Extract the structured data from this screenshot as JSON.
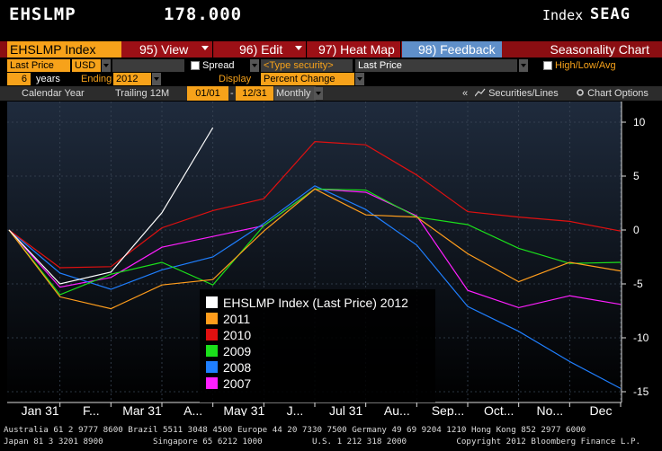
{
  "header": {
    "ticker": "EHSLMP",
    "last_value": "178.000",
    "index_label": "Index",
    "index_code": "SEAG"
  },
  "menu": {
    "security": "EHSLMP Index",
    "view": "95) View",
    "edit": "96) Edit",
    "heat_map": "97) Heat Map",
    "feedback": "98) Feedback",
    "title": "Seasonality Chart"
  },
  "controls": {
    "field": "Last Price",
    "currency": "USD",
    "spread_label": "Spread",
    "type_security_placeholder": "<Type security>",
    "field2": "Last Price",
    "high_low_avg": "High/Low/Avg",
    "years_value": "6",
    "years_label": "years",
    "ending_label": "Ending",
    "ending_value": "2012",
    "display_label": "Display",
    "display_value": "Percent Change"
  },
  "toolbar": {
    "calendar_year": "Calendar Year",
    "trailing": "Trailing 12M",
    "start": "01/01",
    "dash": "-",
    "end": "12/31",
    "period": "Monthly",
    "collapse": "«",
    "securities_lines": "Securities/Lines",
    "chart_options": "Chart Options"
  },
  "chart_data": {
    "type": "line",
    "categories": [
      "Jan 31",
      "F...",
      "Mar 31",
      "A...",
      "May 31",
      "J...",
      "Jul 31",
      "Au...",
      "Sep...",
      "Oct...",
      "No...",
      "Dec"
    ],
    "ylim": [
      -16,
      11
    ],
    "yticks": [
      10,
      5,
      0,
      -5,
      -10,
      -15
    ],
    "series": [
      {
        "name": "EHSLMP Index (Last Price) 2012",
        "color": "#ffffff",
        "values": [
          0,
          -5.0,
          -3.9,
          1.6,
          9.5
        ]
      },
      {
        "name": "2011",
        "color": "#ff9d1c",
        "values": [
          0,
          -6.2,
          -7.3,
          -5.1,
          -4.6,
          -0.1,
          3.8,
          1.4,
          1.2,
          -2.2,
          -4.8,
          -3.0,
          -3.8
        ]
      },
      {
        "name": "2010",
        "color": "#e01010",
        "values": [
          0,
          -3.5,
          -3.4,
          0.2,
          1.8,
          2.9,
          8.2,
          7.9,
          5.1,
          1.7,
          1.2,
          0.8,
          -0.1
        ]
      },
      {
        "name": "2009",
        "color": "#1be01b",
        "values": [
          0,
          -6.0,
          -4.1,
          -3.0,
          -5.1,
          0.4,
          3.8,
          3.7,
          1.2,
          0.5,
          -1.7,
          -3.1,
          -3.0
        ]
      },
      {
        "name": "2008",
        "color": "#1f7fff",
        "values": [
          0,
          -4.0,
          -5.5,
          -3.7,
          -2.5,
          0.6,
          4.1,
          1.9,
          -1.4,
          -7.1,
          -9.4,
          -12.2,
          -14.7
        ]
      },
      {
        "name": "2007",
        "color": "#ff1fff",
        "values": [
          0,
          -5.3,
          -4.4,
          -1.6,
          -0.6,
          0.4,
          3.8,
          3.5,
          1.3,
          -5.6,
          -7.2,
          -6.1,
          -6.9
        ]
      }
    ]
  },
  "footer": {
    "line1": "Australia 61 2 9777 8600 Brazil 5511 3048 4500 Europe 44 20 7330 7500 Germany 49 69 9204 1210 Hong Kong 852 2977 6000",
    "line2": "Japan 81 3 3201 8900          Singapore 65 6212 1000          U.S. 1 212 318 2000          Copyright 2012 Bloomberg Finance L.P."
  }
}
